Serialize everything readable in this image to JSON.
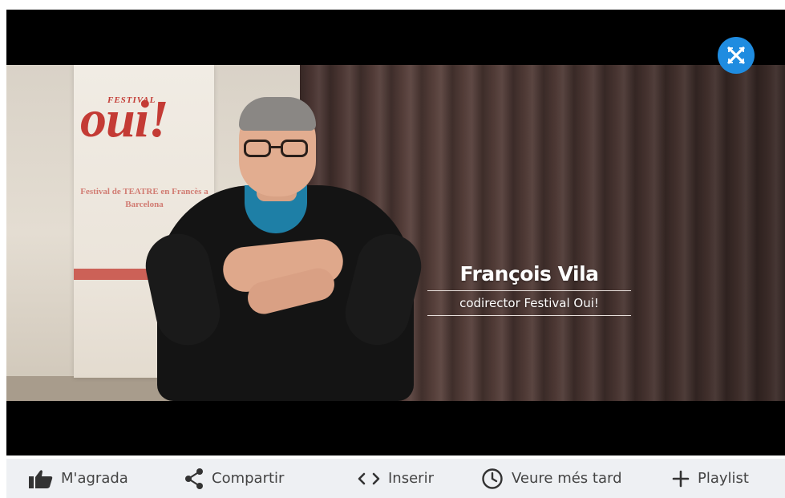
{
  "video": {
    "lower_third": {
      "name": "François Vila",
      "role": "codirector Festival Oui!"
    },
    "banner": {
      "festival": "FESTIVAL",
      "oui": "oui!",
      "text": "Festival de TEATRE en Francès a Barcelona"
    },
    "logo_icon": "x-cross-logo-icon",
    "accent_color": "#1f8ce0"
  },
  "toolbar": {
    "like": {
      "label": "M'agrada",
      "icon": "thumbs-up-icon"
    },
    "share": {
      "label": "Compartir",
      "icon": "share-icon"
    },
    "embed": {
      "label": "Inserir",
      "icon": "code-brackets-icon"
    },
    "later": {
      "label": "Veure més tard",
      "icon": "clock-icon"
    },
    "playlist": {
      "label": "Playlist",
      "icon": "plus-icon"
    }
  }
}
